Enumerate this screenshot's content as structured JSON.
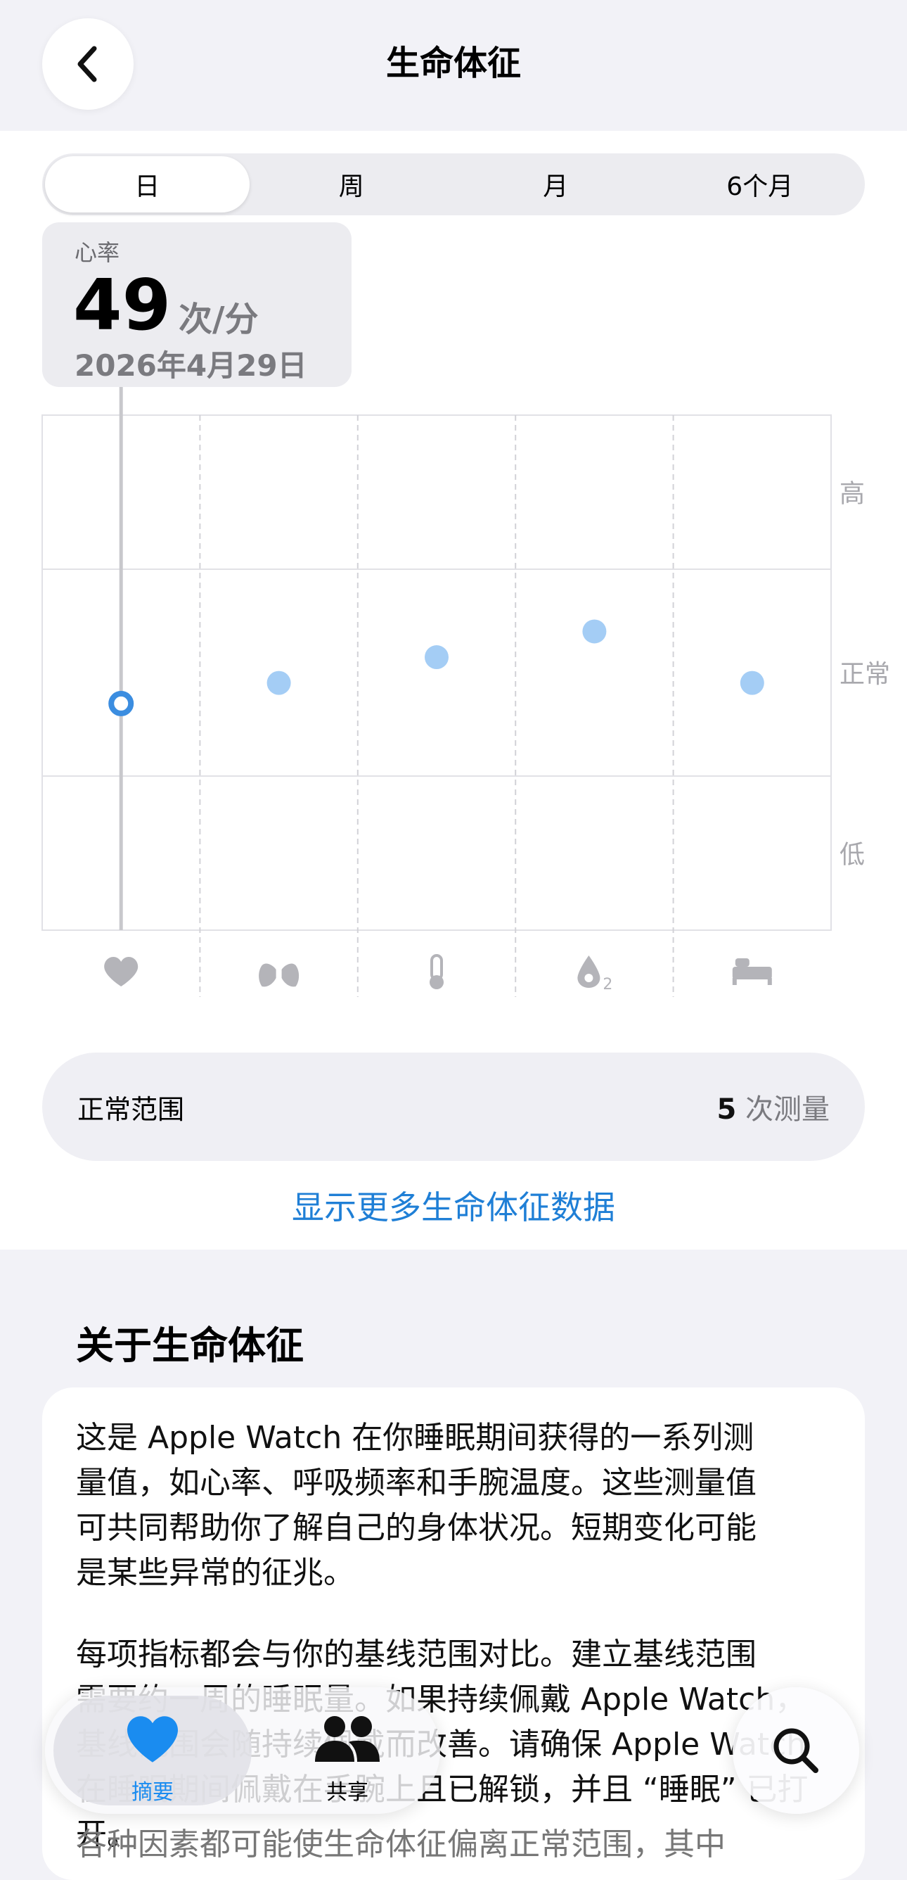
{
  "header": {
    "title": "生命体征",
    "back_icon": "chevron-left-icon"
  },
  "segments": {
    "items": [
      "日",
      "周",
      "月",
      "6个月"
    ],
    "selected": "日"
  },
  "selection": {
    "label": "心率",
    "value": "49",
    "unit": "次/分",
    "date": "2026年4月29日"
  },
  "chart_data": {
    "type": "scatter",
    "categories": [
      "heart-rate",
      "respiratory-rate",
      "wrist-temperature",
      "blood-oxygen",
      "sleeping-duration"
    ],
    "category_icons": [
      "heart-icon",
      "lungs-icon",
      "thermometer-icon",
      "blood-oxygen-icon",
      "bed-icon"
    ],
    "values": [
      0.44,
      0.48,
      0.53,
      0.58,
      0.48
    ],
    "selected_index": 0,
    "y_labels": [
      "高",
      "正常",
      "低"
    ],
    "point_color": "#a4cdf5",
    "selected_color": "#3b8de0",
    "grid": true
  },
  "normal_range": {
    "label": "正常范围",
    "count": "5",
    "count_suffix": "次测量"
  },
  "more_link": "显示更多生命体征数据",
  "about": {
    "heading": "关于生命体征",
    "paragraphs": [
      [
        "这是 Apple Watch 在你睡眠期间获得的一系列测",
        "量值，如心率、呼吸频率和手腕温度。这些测量值",
        "可共同帮助你了解自己的身体状况。短期变化可能",
        "是某些异常的征兆。"
      ],
      [
        "每项指标都会与你的基线范围对比。建立基线范围",
        "需要约一周的睡眠量。如果持续佩戴 Apple Watch，",
        "基线范围会随持续佩戴而改善。请确保 Apple Watch",
        "在睡眠期间佩戴在手腕上且已解锁，并且 “睡眠” 已打开。"
      ],
      [
        "各种因素都可能使生命体征偏离正常范围，其中"
      ]
    ]
  },
  "tabbar": {
    "summary_label": "摘要",
    "summary_icon": "heart-icon",
    "sharing_label": "共享",
    "sharing_icon": "people-icon",
    "search_icon": "search-icon",
    "accent": "#1a8cf0"
  }
}
